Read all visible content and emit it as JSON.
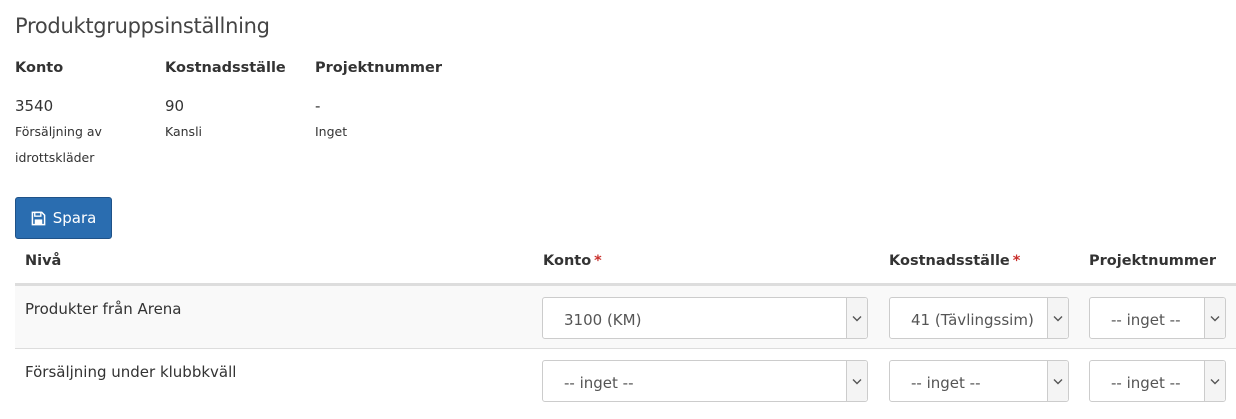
{
  "title": "Produktgruppsinställning",
  "summary": {
    "konto": {
      "header": "Konto",
      "value": "3540",
      "desc": "Försäljning av idrottskläder"
    },
    "kostnadsstalle": {
      "header": "Kostnadsställe",
      "value": "90",
      "desc": "Kansli"
    },
    "projektnummer": {
      "header": "Projektnummer",
      "value": "-",
      "desc": "Inget"
    }
  },
  "save_button": {
    "label": "Spara",
    "icon": "floppy-disk-icon"
  },
  "table": {
    "headers": {
      "niva": "Nivå",
      "konto": "Konto",
      "kostnadsstalle": "Kostnadsställe",
      "projektnummer": "Projektnummer",
      "required_marker": "*"
    },
    "rows": [
      {
        "label": "Produkter från Arena",
        "konto": "3100 (KM)",
        "kostnadsstalle": "41 (Tävlingssim)",
        "projektnummer": "-- inget --"
      },
      {
        "label": "Försäljning under klubbkväll",
        "konto": "-- inget --",
        "kostnadsstalle": "-- inget --",
        "projektnummer": "-- inget --"
      }
    ]
  },
  "colors": {
    "primary_button": "#2a6db0",
    "required": "#c9302c",
    "row_stripe": "#f9f9f9",
    "border": "#dddddd"
  }
}
